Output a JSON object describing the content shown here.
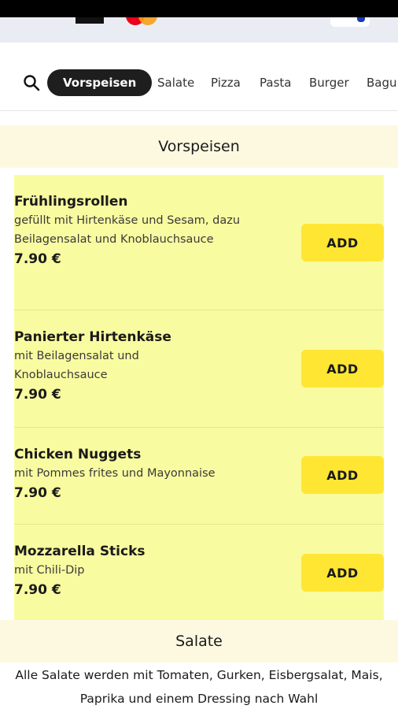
{
  "nav": {
    "categories": [
      "Vorspeisen",
      "Salate",
      "Pizza",
      "Pasta",
      "Burger",
      "Bagu"
    ],
    "active_category": "Vorspeisen"
  },
  "sections": {
    "vorspeisen": {
      "title": "Vorspeisen",
      "items": [
        {
          "name": "Frühlingsrollen",
          "description": "gefüllt mit Hirtenkäse und Sesam, dazu Beilagensalat und Knoblauchsauce",
          "price": "7.90 €",
          "button": "ADD"
        },
        {
          "name": "Panierter Hirtenkäse",
          "description": "mit Beilagensalat und Knoblauchsauce",
          "price": "7.90 €",
          "button": "ADD"
        },
        {
          "name": "Chicken Nuggets",
          "description": "mit Pommes frites und Mayonnaise",
          "price": "7.90 €",
          "button": "ADD"
        },
        {
          "name": "Mozzarella Sticks",
          "description": "mit Chili-Dip",
          "price": "7.90 €",
          "button": "ADD"
        }
      ]
    },
    "salate": {
      "title": "Salate",
      "note": "Alle Salate werden mit Tomaten, Gurken, Eisbergsalat, Mais, Paprika und einem Dressing nach Wahl"
    }
  },
  "colors": {
    "active_tab_bg": "#1e1e1e",
    "section_header_bg": "#fdf9e1",
    "items_panel_bg": "#f9fba0",
    "add_button_bg": "#ffe633"
  },
  "icons": {
    "search": "search-icon"
  }
}
